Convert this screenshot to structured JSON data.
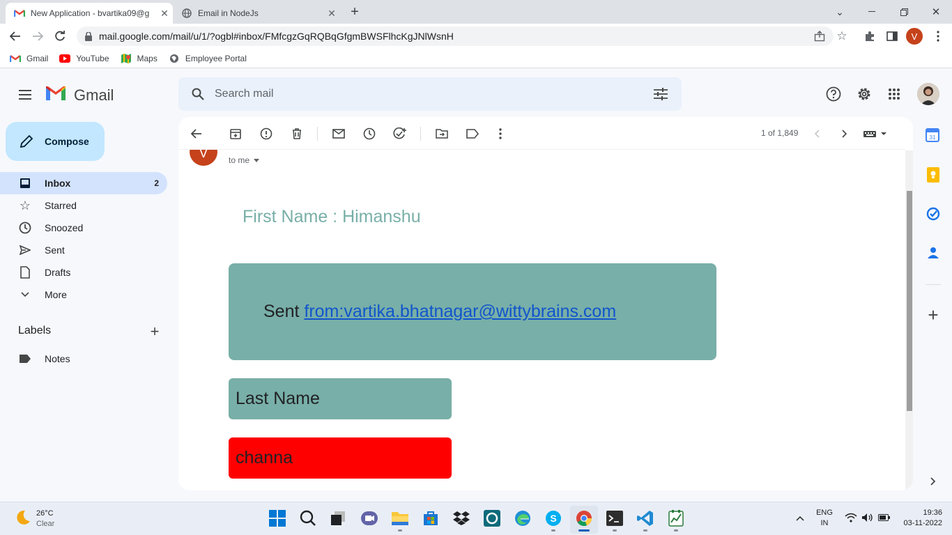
{
  "browser": {
    "tabs": [
      {
        "title": "New Application - bvartika09@g",
        "active": true
      },
      {
        "title": "Email in NodeJs",
        "active": false
      }
    ],
    "url": "mail.google.com/mail/u/1/?ogbl#inbox/FMfcgzGqRQBqGfgmBWSFlhcKgJNlWsnH",
    "profile_initial": "V",
    "bookmarks": [
      "Gmail",
      "YouTube",
      "Maps",
      "Employee Portal"
    ]
  },
  "gmail": {
    "logo_text": "Gmail",
    "search_placeholder": "Search mail",
    "compose_label": "Compose",
    "nav": [
      {
        "label": "Inbox",
        "count": "2",
        "icon": "inbox-icon"
      },
      {
        "label": "Starred",
        "count": "",
        "icon": "star-icon"
      },
      {
        "label": "Snoozed",
        "count": "",
        "icon": "clock-icon"
      },
      {
        "label": "Sent",
        "count": "",
        "icon": "send-icon"
      },
      {
        "label": "Drafts",
        "count": "",
        "icon": "draft-icon"
      },
      {
        "label": "More",
        "count": "",
        "icon": "chevron-down-icon"
      }
    ],
    "labels_heading": "Labels",
    "labels": [
      "Notes"
    ],
    "pagination": "1 of 1,849"
  },
  "email": {
    "sender_initial": "V",
    "to_me": "to me",
    "first_name_line": "First Name : Himanshu",
    "sent_prefix": "Sent ",
    "sent_link": "from:vartika.bhatnagar@wittybrains.com",
    "last_name_label": "Last Name",
    "last_name_value": "channa",
    "colors": {
      "teal_box": "#78afa8",
      "red_box": "#ff0000",
      "first_name": "#78afa8"
    }
  },
  "taskbar": {
    "weather_temp": "26°C",
    "weather_desc": "Clear",
    "lang_top": "ENG",
    "lang_bottom": "IN",
    "time": "19:36",
    "date": "03-11-2022"
  }
}
